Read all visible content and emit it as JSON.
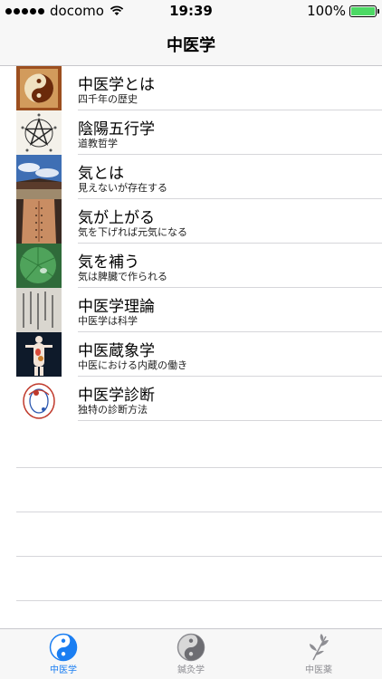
{
  "status_bar": {
    "carrier": "docomo",
    "time": "19:39",
    "battery": "100%",
    "battery_level": 1.0,
    "icons": [
      "signal-dots-icon",
      "wifi-icon",
      "battery-icon"
    ]
  },
  "nav": {
    "title": "中医学"
  },
  "rows": [
    {
      "title": "中医学とは",
      "subtitle": "四千年の歴史",
      "icon": "yin-yang-thumbnail"
    },
    {
      "title": "陰陽五行学",
      "subtitle": "道教哲学",
      "icon": "pentagram-thumbnail"
    },
    {
      "title": "気とは",
      "subtitle": "見えないが存在する",
      "icon": "sky-building-thumbnail"
    },
    {
      "title": "気が上がる",
      "subtitle": "気を下げれば元気になる",
      "icon": "back-acupoints-thumbnail"
    },
    {
      "title": "気を補う",
      "subtitle": "気は脾臓で作られる",
      "icon": "lotus-leaf-thumbnail"
    },
    {
      "title": "中医学理論",
      "subtitle": "中医学は科学",
      "icon": "old-text-thumbnail"
    },
    {
      "title": "中医蔵象学",
      "subtitle": "中医における内蔵の働き",
      "icon": "organs-figure-thumbnail"
    },
    {
      "title": "中医学診断",
      "subtitle": "独特の診断方法",
      "icon": "meridian-chart-thumbnail"
    }
  ],
  "tabs": [
    {
      "label": "中医学",
      "icon": "yin-yang-icon",
      "active": true
    },
    {
      "label": "鍼灸学",
      "icon": "yin-yang-gray-icon",
      "active": false
    },
    {
      "label": "中医薬",
      "icon": "herb-leaf-icon",
      "active": false
    }
  ],
  "colors": {
    "accent": "#1a7ef2",
    "inactive": "#8e8e93",
    "battery": "#4cd964"
  }
}
